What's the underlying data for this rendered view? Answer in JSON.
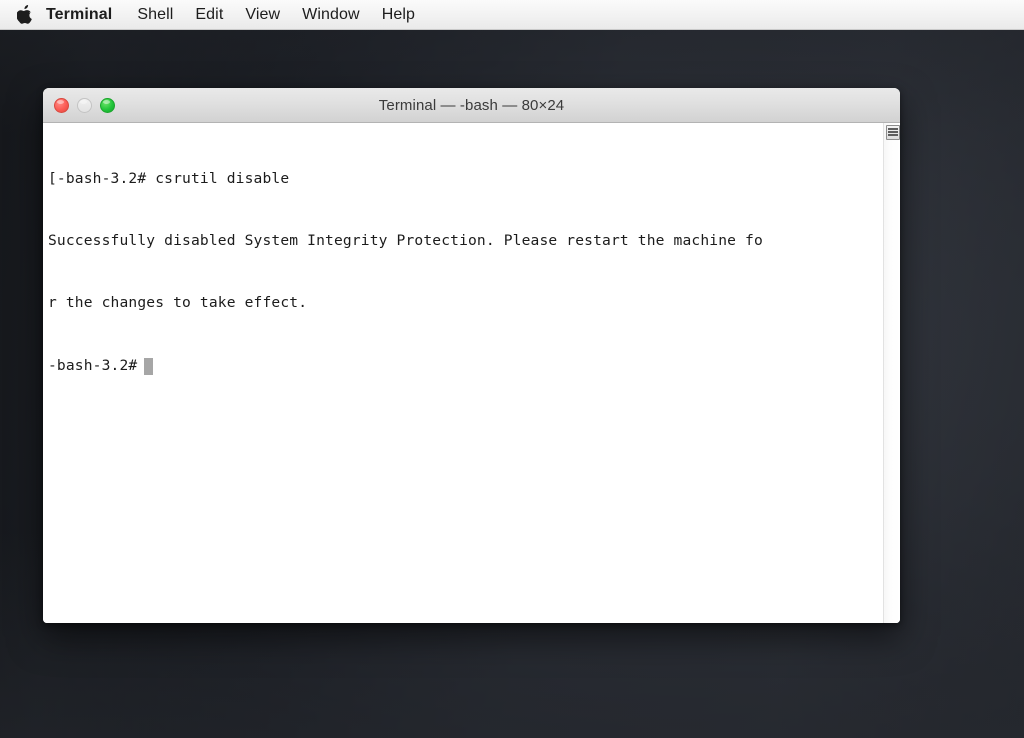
{
  "menubar": {
    "apple_icon": "apple-logo-icon",
    "items": [
      {
        "label": "Terminal",
        "bold": true
      },
      {
        "label": "Shell",
        "bold": false
      },
      {
        "label": "Edit",
        "bold": false
      },
      {
        "label": "View",
        "bold": false
      },
      {
        "label": "Window",
        "bold": false
      },
      {
        "label": "Help",
        "bold": false
      }
    ]
  },
  "window": {
    "title": "Terminal — -bash — 80×24",
    "controls": {
      "close": "close-button",
      "minimize": "minimize-button",
      "zoom": "zoom-button"
    }
  },
  "terminal": {
    "lines": [
      "[-bash-3.2# csrutil disable",
      "Successfully disabled System Integrity Protection. Please restart the machine fo",
      "r the changes to take effect."
    ],
    "prompt": "-bash-3.2#",
    "cursor": "block-cursor",
    "columns": "80",
    "rows": "24"
  },
  "scrollbar": {
    "thumb": "scroll-thumb"
  },
  "colors": {
    "desktop_background": "#4a4d53",
    "titlebar_background": "#e0e0e0",
    "terminal_background": "#ffffff",
    "terminal_text": "#1c1c1c",
    "close_button": "#fb5b54",
    "minimize_button": "#e2e2e2",
    "zoom_button": "#22c53a",
    "cursor": "#a6a6a6"
  }
}
